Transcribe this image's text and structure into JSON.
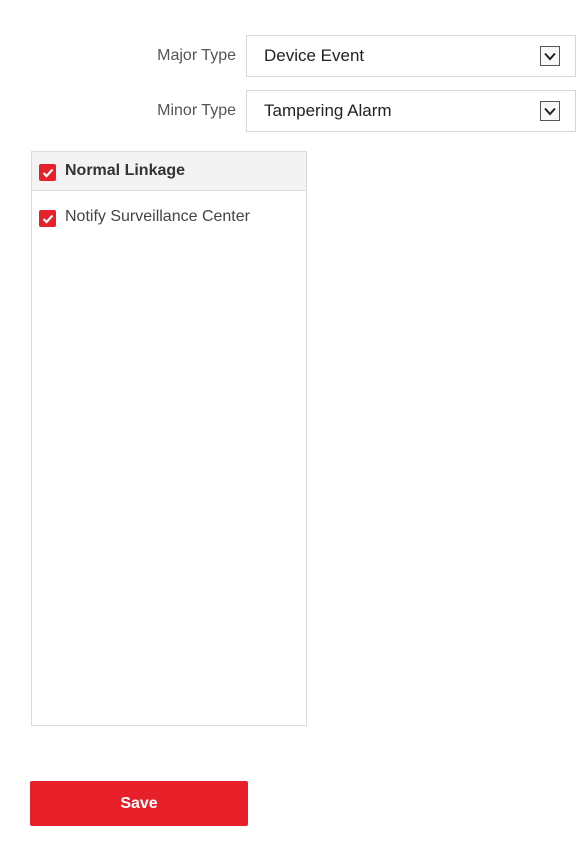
{
  "form": {
    "major_type": {
      "label": "Major Type",
      "value": "Device Event"
    },
    "minor_type": {
      "label": "Minor Type",
      "value": "Tampering Alarm"
    }
  },
  "linkage": {
    "header": {
      "label": "Normal Linkage",
      "checked": true
    },
    "items": [
      {
        "label": "Notify Surveillance Center",
        "checked": true
      }
    ]
  },
  "actions": {
    "save_label": "Save"
  },
  "colors": {
    "accent": "#e8202a",
    "panel_header": "#f3f3f3",
    "border": "#dcdcdc"
  },
  "icons": {
    "checkbox": "checkmark-icon",
    "dropdown": "chevron-down-icon"
  }
}
